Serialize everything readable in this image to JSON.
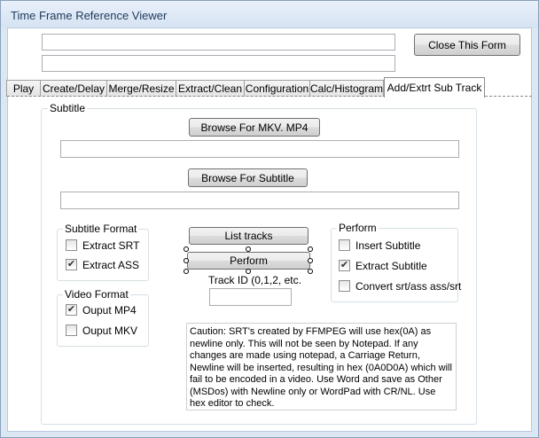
{
  "window": {
    "title": "Time Frame Reference Viewer"
  },
  "header": {
    "field1": "",
    "field2": "",
    "close_label": "Close This Form"
  },
  "tabs": [
    {
      "label": "Play"
    },
    {
      "label": "Create/Delay"
    },
    {
      "label": "Merge/Resize"
    },
    {
      "label": "Extract/Clean"
    },
    {
      "label": "Configuration"
    },
    {
      "label": "Calc/Histogram"
    },
    {
      "label": "Add/Extrt Sub Track",
      "active": true
    }
  ],
  "subtitle_group": {
    "label": "Subtitle",
    "browse_mkv_label": "Browse For MKV. MP4",
    "mkv_path": "",
    "browse_sub_label": "Browse For Subtitle",
    "sub_path": ""
  },
  "subtitle_format": {
    "label": "Subtitle Format",
    "options": [
      {
        "label": "Extract SRT",
        "checked": false
      },
      {
        "label": "Extract ASS",
        "checked": true
      }
    ]
  },
  "video_format": {
    "label": "Video Format",
    "options": [
      {
        "label": "Ouput MP4",
        "checked": true
      },
      {
        "label": "Ouput MKV",
        "checked": false
      }
    ]
  },
  "center": {
    "list_tracks_label": "List tracks",
    "perform_label": "Perform",
    "track_id_label": "Track ID (0,1,2, etc.",
    "track_id_value": ""
  },
  "perform_group": {
    "label": "Perform",
    "options": [
      {
        "label": "Insert Subtitle",
        "checked": false
      },
      {
        "label": "Extract Subtitle",
        "checked": true
      },
      {
        "label": "Convert srt/ass ass/srt",
        "checked": false
      }
    ]
  },
  "caution_text": "Caution: SRT's created by FFMPEG will use hex(0A) as newline only.  This will not be seen by Notepad.  If any changes are made using notepad, a Carriage Return, Newline will be inserted, resulting in hex (0A0D0A) which will fail to be encoded in a video. Use Word and save as Other (MSDos) with Newline only or WordPad with CR/NL. Use hex editor to  check.",
  "check_mark": "✔"
}
